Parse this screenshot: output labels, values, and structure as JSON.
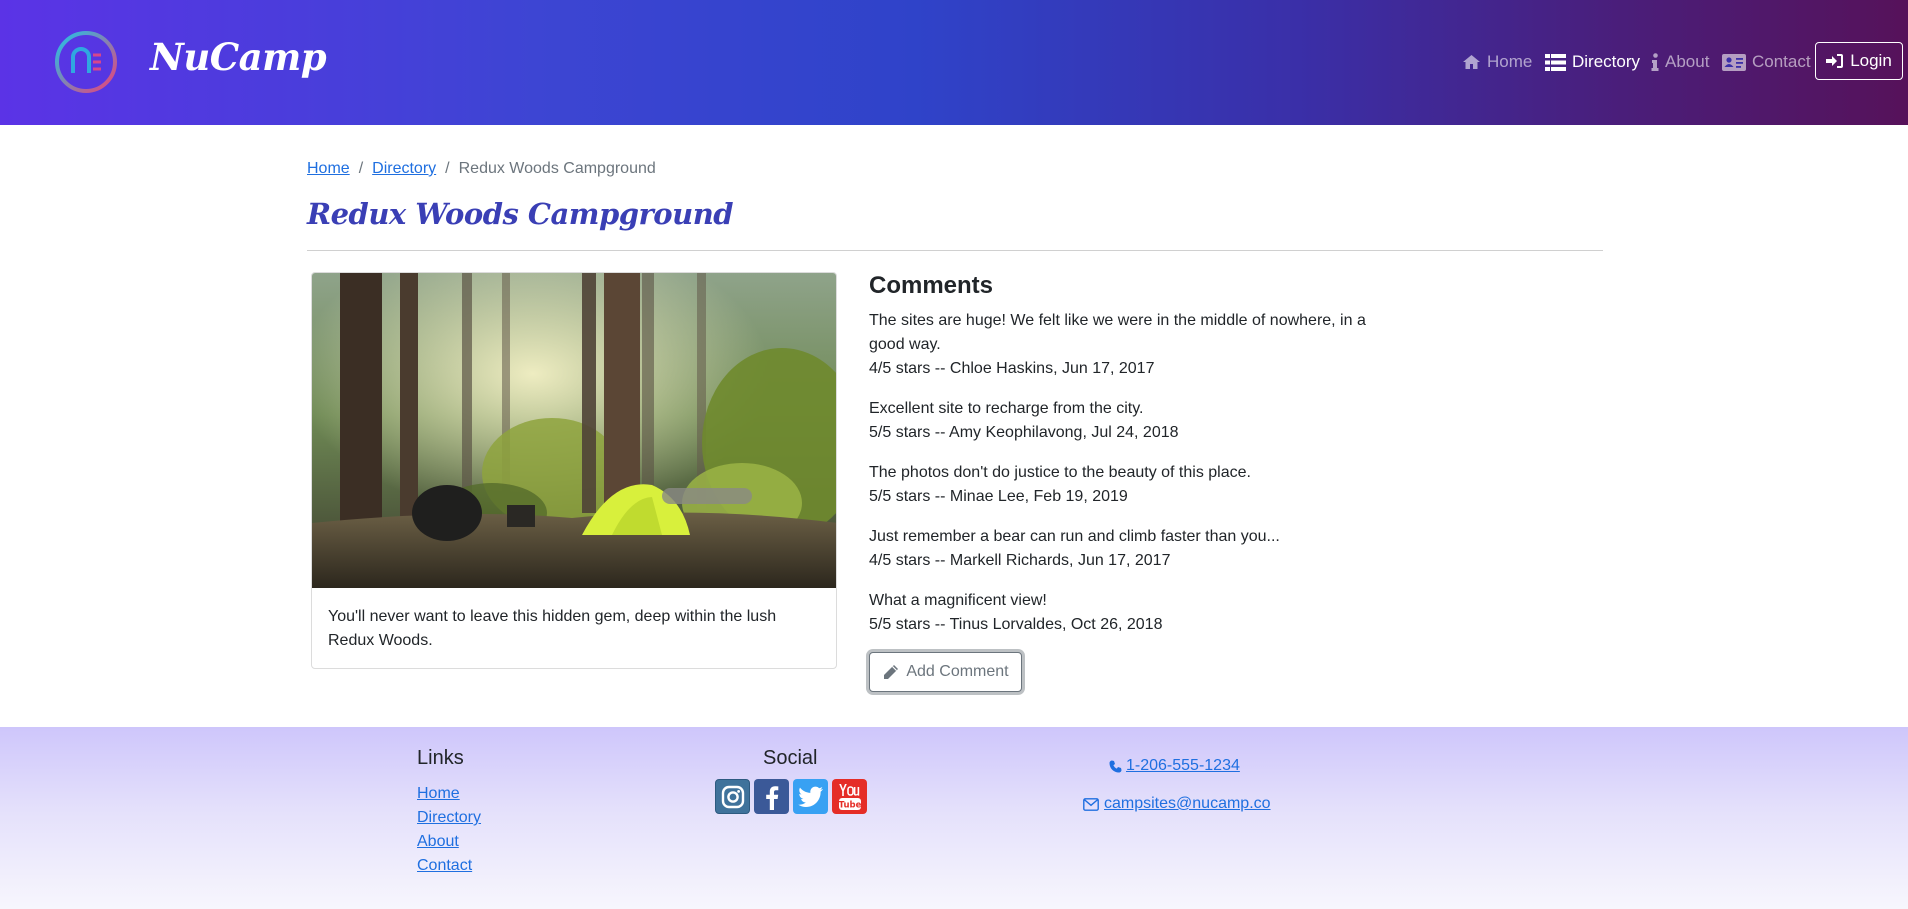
{
  "header": {
    "brand": "NuCamp",
    "logo_icon": "nucamp-logo-icon",
    "nav": [
      {
        "label": "Home",
        "icon": "home-icon",
        "active": false
      },
      {
        "label": "Directory",
        "icon": "list-icon",
        "active": true
      },
      {
        "label": "About",
        "icon": "info-icon",
        "active": false
      },
      {
        "label": "Contact",
        "icon": "address-card-icon",
        "active": false
      }
    ],
    "login_label": "Login",
    "gradient_colors": [
      "#5b33e6",
      "#2f43c9",
      "#56125a"
    ]
  },
  "breadcrumb": {
    "items": [
      "Home",
      "Directory"
    ],
    "separator": "/",
    "current": "Redux Woods Campground"
  },
  "page_title": "Redux Woods Campground",
  "campsite": {
    "description": "You'll never want to leave this hidden gem, deep within the lush Redux Woods."
  },
  "comments": {
    "title": "Comments",
    "items": [
      {
        "text": "The sites are huge! We felt like we were in the middle of nowhere, in a good way.",
        "meta": "4/5 stars -- Chloe Haskins, Jun 17, 2017"
      },
      {
        "text": "Excellent site to recharge from the city.",
        "meta": "5/5 stars -- Amy Keophilavong, Jul 24, 2018"
      },
      {
        "text": "The photos don't do justice to the beauty of this place.",
        "meta": "5/5 stars -- Minae Lee, Feb 19, 2019"
      },
      {
        "text": "Just remember a bear can run and climb faster than you...",
        "meta": "4/5 stars -- Markell Richards, Jun 17, 2017"
      },
      {
        "text": "What a magnificent view!",
        "meta": "5/5 stars -- Tinus Lorvaldes, Oct 26, 2018"
      }
    ],
    "add_label": "Add Comment"
  },
  "footer": {
    "links_title": "Links",
    "links": [
      "Home",
      "Directory",
      "About",
      "Contact"
    ],
    "social_title": "Social",
    "social": [
      "instagram-icon",
      "facebook-icon",
      "twitter-icon",
      "youtube-icon"
    ],
    "phone": " 1-206-555-1234",
    "email": " campsites@nucamp.co"
  }
}
